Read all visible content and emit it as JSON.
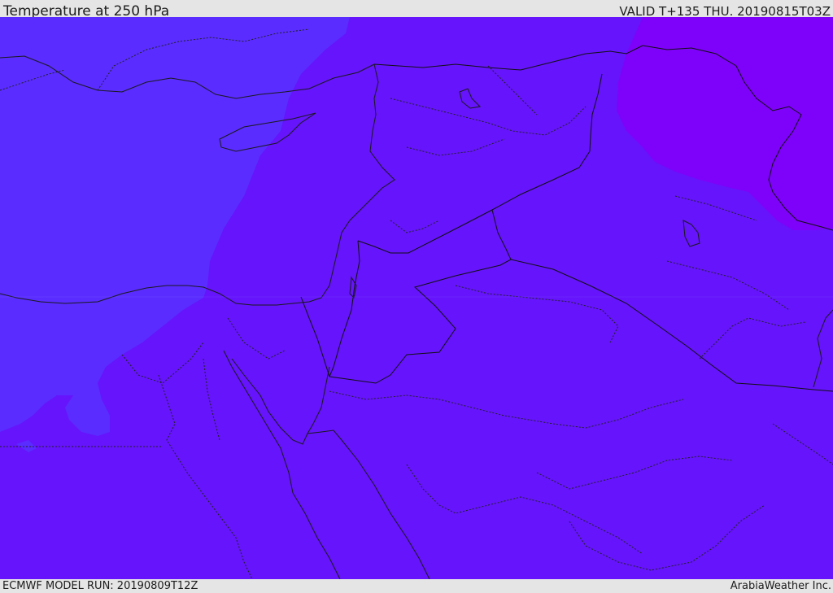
{
  "header": {
    "title": "Temperature at 250 hPa",
    "valid": "VALID T+135 THU. 20190815T03Z"
  },
  "footer": {
    "model_run": "ECMWF MODEL RUN: 20190809T12Z",
    "credit": "ArabiaWeather Inc."
  },
  "map": {
    "field": "temperature",
    "level": "250 hPa",
    "colors": {
      "warm_blue": "#5a2cff",
      "mid_violet": "#6614fb",
      "cold_violet": "#7e02f9",
      "coastline": "#1a1a1a",
      "border": "#111111",
      "internal_border": "#222222"
    }
  }
}
